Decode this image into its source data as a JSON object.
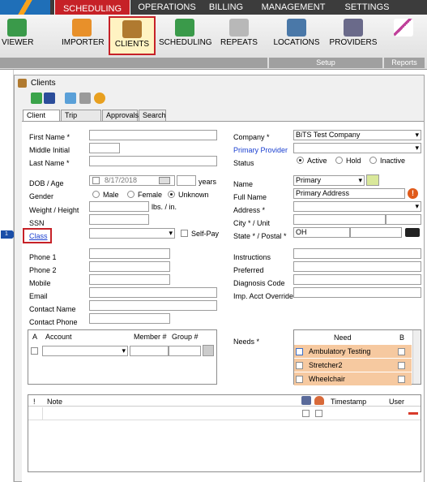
{
  "nav": {
    "items": [
      "SCHEDULING",
      "OPERATIONS",
      "BILLING",
      "MANAGEMENT",
      "SETTINGS"
    ],
    "active": "SCHEDULING"
  },
  "ribbon": {
    "buttons": [
      "VIEWER",
      "IMPORTER",
      "CLIENTS",
      "SCHEDULING",
      "REPEATS",
      "LOCATIONS",
      "PROVIDERS"
    ],
    "selected": "CLIENTS",
    "groups": [
      "Setup",
      "Reports"
    ]
  },
  "window": {
    "title": "Clients",
    "tabs": [
      "Client Info",
      "Trip History",
      "Approvals",
      "Search"
    ],
    "active_tab": "Client Info"
  },
  "marker": "1",
  "left": {
    "first_name_label": "First Name *",
    "middle_initial_label": "Middle Initial",
    "last_name_label": "Last Name *",
    "dob_label": "DOB / Age",
    "dob_value": "8/17/2018",
    "years_label": "years",
    "gender_label": "Gender",
    "gender_options": [
      "Male",
      "Female",
      "Unknown"
    ],
    "weight_label": "Weight / Height",
    "units_label": "lbs. / in.",
    "ssn_label": "SSN",
    "class_label": "Class",
    "selfpay_label": "Self-Pay",
    "phone1_label": "Phone 1",
    "phone2_label": "Phone 2",
    "mobile_label": "Mobile",
    "email_label": "Email",
    "contact_name_label": "Contact Name",
    "contact_phone_label": "Contact Phone"
  },
  "right": {
    "company_label": "Company *",
    "company_value": "BiTS Test Company",
    "primary_provider_label": "Primary Provider",
    "status_label": "Status",
    "status_options": [
      "Active",
      "Hold",
      "Inactive"
    ],
    "name_label": "Name",
    "name_value": "Primary",
    "full_name_label": "Full Name",
    "full_name_value": "Primary Address",
    "address_label": "Address *",
    "city_label": "City * / Unit",
    "state_label": "State * / Postal *",
    "state_value": "OH",
    "instructions_label": "Instructions",
    "preferred_label": "Preferred",
    "diagnosis_label": "Diagnosis Code",
    "imp_acct_label": "Imp. Acct Override",
    "needs_label": "Needs *"
  },
  "account_grid": {
    "headers": [
      "A",
      "Account",
      "Member #",
      "Group #"
    ]
  },
  "needs_grid": {
    "headers": [
      "Need",
      "B"
    ],
    "rows": [
      "Ambulatory Testing",
      "Stretcher2",
      "Wheelchair"
    ],
    "row_color": "#f6c9a0"
  },
  "notes_grid": {
    "headers": [
      "!",
      "Note",
      "Timestamp",
      "User"
    ]
  },
  "colors": {
    "highlight": "#c62127",
    "nav_bg": "#3c3c3c",
    "link": "#1a3fd0"
  }
}
